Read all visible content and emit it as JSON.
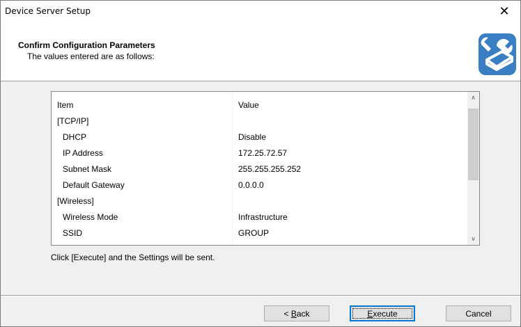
{
  "window": {
    "title": "Device Server Setup",
    "close_glyph": "✕"
  },
  "header": {
    "title": "Confirm Configuration Parameters",
    "subtitle": "The values entered are as follows:",
    "icon": "wrench-device-icon"
  },
  "table": {
    "columns": [
      "Item",
      "Value"
    ],
    "rows": [
      {
        "item": "[TCP/IP]",
        "value": ""
      },
      {
        "item": "DHCP",
        "value": "Disable"
      },
      {
        "item": "IP Address",
        "value": "172.25.72.57"
      },
      {
        "item": "Subnet Mask",
        "value": "255.255.255.252"
      },
      {
        "item": "Default Gateway",
        "value": "0.0.0.0"
      },
      {
        "item": "[Wireless]",
        "value": ""
      },
      {
        "item": "Wireless Mode",
        "value": "Infrastructure"
      },
      {
        "item": "SSID",
        "value": "GROUP"
      }
    ],
    "scroll_up_glyph": "∧",
    "scroll_down_glyph": "∨"
  },
  "note": "Click [Execute] and the Settings will be sent.",
  "buttons": {
    "back_prefix": "< ",
    "back_mnemonic": "B",
    "back_rest": "ack",
    "execute_mnemonic": "E",
    "execute_rest": "xecute",
    "cancel": "Cancel"
  },
  "colors": {
    "accent": "#0078d7",
    "icon_blue": "#3a7fc4"
  }
}
